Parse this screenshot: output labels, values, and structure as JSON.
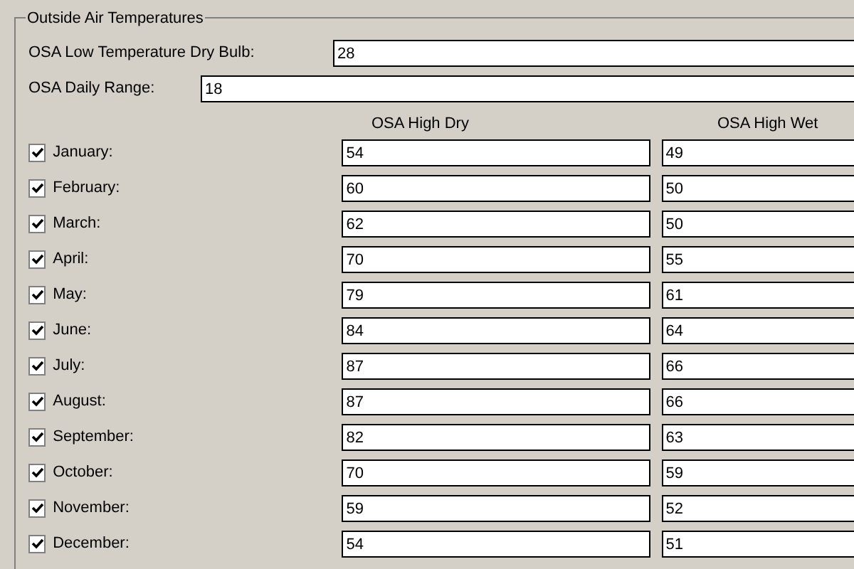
{
  "group": {
    "title": "Outside Air Temperatures"
  },
  "low_dry_bulb": {
    "label": "OSA Low Temperature Dry Bulb:",
    "value": "28"
  },
  "daily_range": {
    "label": "OSA Daily Range:",
    "value": "18"
  },
  "columns": [
    "OSA High Dry",
    "OSA High Wet"
  ],
  "months": [
    {
      "name": "January:",
      "checked": true,
      "high_dry": "54",
      "high_wet": "49"
    },
    {
      "name": "February:",
      "checked": true,
      "high_dry": "60",
      "high_wet": "50"
    },
    {
      "name": "March:",
      "checked": true,
      "high_dry": "62",
      "high_wet": "50"
    },
    {
      "name": "April:",
      "checked": true,
      "high_dry": "70",
      "high_wet": "55"
    },
    {
      "name": "May:",
      "checked": true,
      "high_dry": "79",
      "high_wet": "61"
    },
    {
      "name": "June:",
      "checked": true,
      "high_dry": "84",
      "high_wet": "64"
    },
    {
      "name": "July:",
      "checked": true,
      "high_dry": "87",
      "high_wet": "66"
    },
    {
      "name": "August:",
      "checked": true,
      "high_dry": "87",
      "high_wet": "66"
    },
    {
      "name": "September:",
      "checked": true,
      "high_dry": "82",
      "high_wet": "63"
    },
    {
      "name": "October:",
      "checked": true,
      "high_dry": "70",
      "high_wet": "59"
    },
    {
      "name": "November:",
      "checked": true,
      "high_dry": "59",
      "high_wet": "52"
    },
    {
      "name": "December:",
      "checked": true,
      "high_dry": "54",
      "high_wet": "51"
    }
  ]
}
